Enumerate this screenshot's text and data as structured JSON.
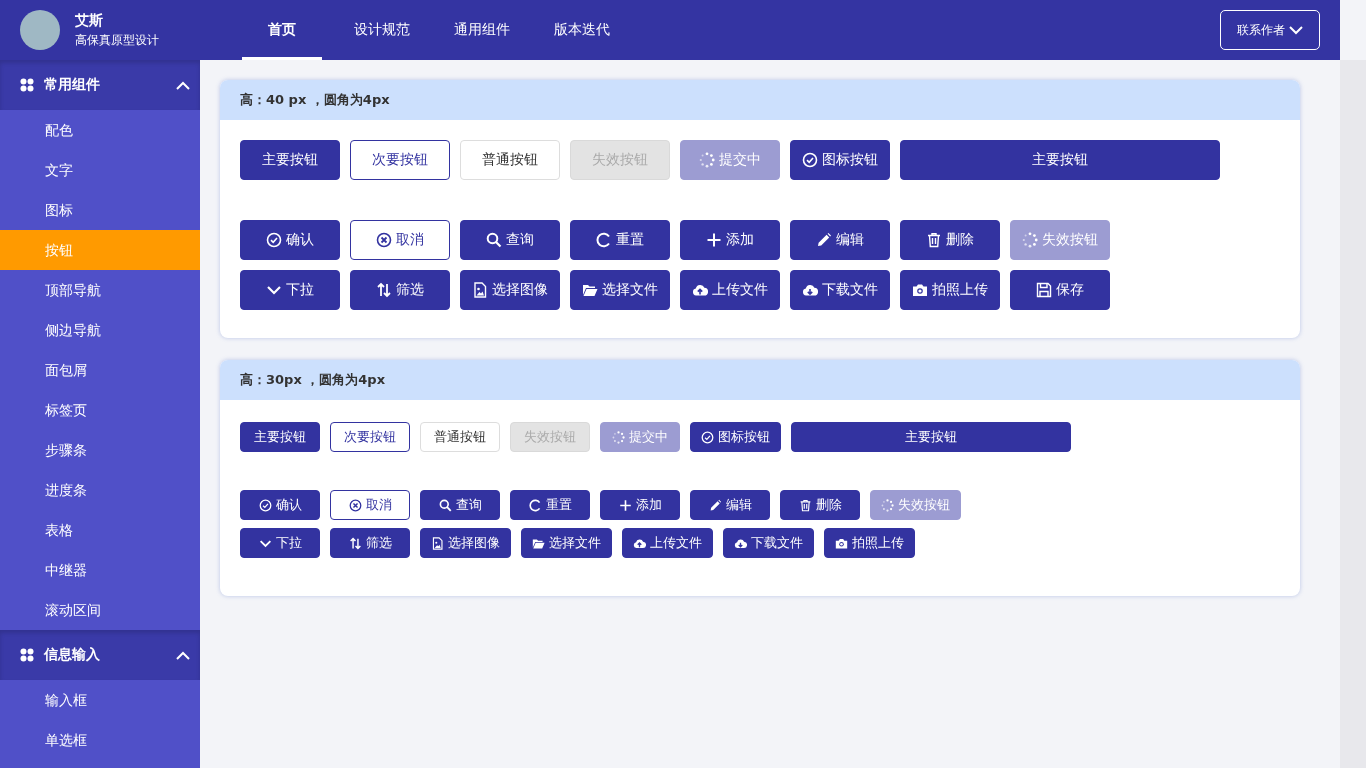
{
  "header": {
    "user": {
      "name": "艾斯",
      "subtitle": "高保真原型设计"
    },
    "tabs": [
      {
        "label": "首页",
        "selected": true
      },
      {
        "label": "设计规范",
        "selected": false
      },
      {
        "label": "通用组件",
        "selected": false
      },
      {
        "label": "版本迭代",
        "selected": false
      }
    ],
    "contact_button": "联系作者"
  },
  "sidebar": {
    "groups": [
      {
        "title": "常用组件",
        "expanded": true,
        "items": [
          {
            "label": "配色",
            "selected": false
          },
          {
            "label": "文字",
            "selected": false
          },
          {
            "label": "图标",
            "selected": false
          },
          {
            "label": "按钮",
            "selected": true
          },
          {
            "label": "顶部导航",
            "selected": false
          },
          {
            "label": "侧边导航",
            "selected": false
          },
          {
            "label": "面包屑",
            "selected": false
          },
          {
            "label": "标签页",
            "selected": false
          },
          {
            "label": "步骤条",
            "selected": false
          },
          {
            "label": "进度条",
            "selected": false
          },
          {
            "label": "表格",
            "selected": false
          },
          {
            "label": "中继器",
            "selected": false
          },
          {
            "label": "滚动区间",
            "selected": false
          }
        ]
      },
      {
        "title": "信息输入",
        "expanded": true,
        "items": [
          {
            "label": "输入框",
            "selected": false
          },
          {
            "label": "单选框",
            "selected": false
          }
        ]
      }
    ]
  },
  "sections": [
    {
      "title": "高：40 px ，圆角为4px",
      "kind": "large",
      "groups": [
        {
          "buttons": [
            {
              "label": "主要按钮",
              "kind": "primary"
            },
            {
              "label": "次要按钮",
              "kind": "secondary"
            },
            {
              "label": "普通按钮",
              "kind": "plain"
            },
            {
              "label": "失效按钮",
              "kind": "disabled"
            },
            {
              "label": "提交中",
              "kind": "loading"
            },
            {
              "label": "图标按钮",
              "kind": "check"
            },
            {
              "label": "主要按钮",
              "kind": "wide"
            }
          ]
        },
        {
          "buttons": [
            {
              "label": "确认",
              "kind": "check"
            },
            {
              "label": "取消",
              "kind": "cancel"
            },
            {
              "label": "查询",
              "kind": "search"
            },
            {
              "label": "重置",
              "kind": "reset"
            },
            {
              "label": "添加",
              "kind": "add"
            },
            {
              "label": "编辑",
              "kind": "edit"
            },
            {
              "label": "删除",
              "kind": "delete"
            },
            {
              "label": "失效按钮",
              "kind": "loading"
            }
          ]
        },
        {
          "buttons": [
            {
              "label": "下拉",
              "kind": "dropdown"
            },
            {
              "label": "筛选",
              "kind": "sort"
            },
            {
              "label": "选择图像",
              "kind": "image"
            },
            {
              "label": "选择文件",
              "kind": "folder"
            },
            {
              "label": "上传文件",
              "kind": "upload"
            },
            {
              "label": "下载文件",
              "kind": "download"
            },
            {
              "label": "拍照上传",
              "kind": "camera"
            },
            {
              "label": "保存",
              "kind": "save"
            }
          ]
        }
      ]
    },
    {
      "title": "高：30px ，圆角为4px",
      "kind": "small",
      "groups": [
        {
          "buttons": [
            {
              "label": "主要按钮",
              "kind": "primary"
            },
            {
              "label": "次要按钮",
              "kind": "secondary"
            },
            {
              "label": "普通按钮",
              "kind": "plain"
            },
            {
              "label": "失效按钮",
              "kind": "disabled"
            },
            {
              "label": "提交中",
              "kind": "loading"
            },
            {
              "label": "图标按钮",
              "kind": "check"
            },
            {
              "label": "主要按钮",
              "kind": "wide"
            }
          ]
        },
        {
          "buttons": [
            {
              "label": "确认",
              "kind": "check"
            },
            {
              "label": "取消",
              "kind": "cancel"
            },
            {
              "label": "查询",
              "kind": "search"
            },
            {
              "label": "重置",
              "kind": "reset"
            },
            {
              "label": "添加",
              "kind": "add"
            },
            {
              "label": "编辑",
              "kind": "edit"
            },
            {
              "label": "删除",
              "kind": "delete"
            },
            {
              "label": "失效按钮",
              "kind": "loading"
            }
          ]
        },
        {
          "buttons": [
            {
              "label": "下拉",
              "kind": "dropdown"
            },
            {
              "label": "筛选",
              "kind": "sort"
            },
            {
              "label": "选择图像",
              "kind": "image"
            },
            {
              "label": "选择文件",
              "kind": "folder"
            },
            {
              "label": "上传文件",
              "kind": "upload"
            },
            {
              "label": "下载文件",
              "kind": "download"
            },
            {
              "label": "拍照上传",
              "kind": "camera"
            }
          ]
        }
      ]
    }
  ]
}
